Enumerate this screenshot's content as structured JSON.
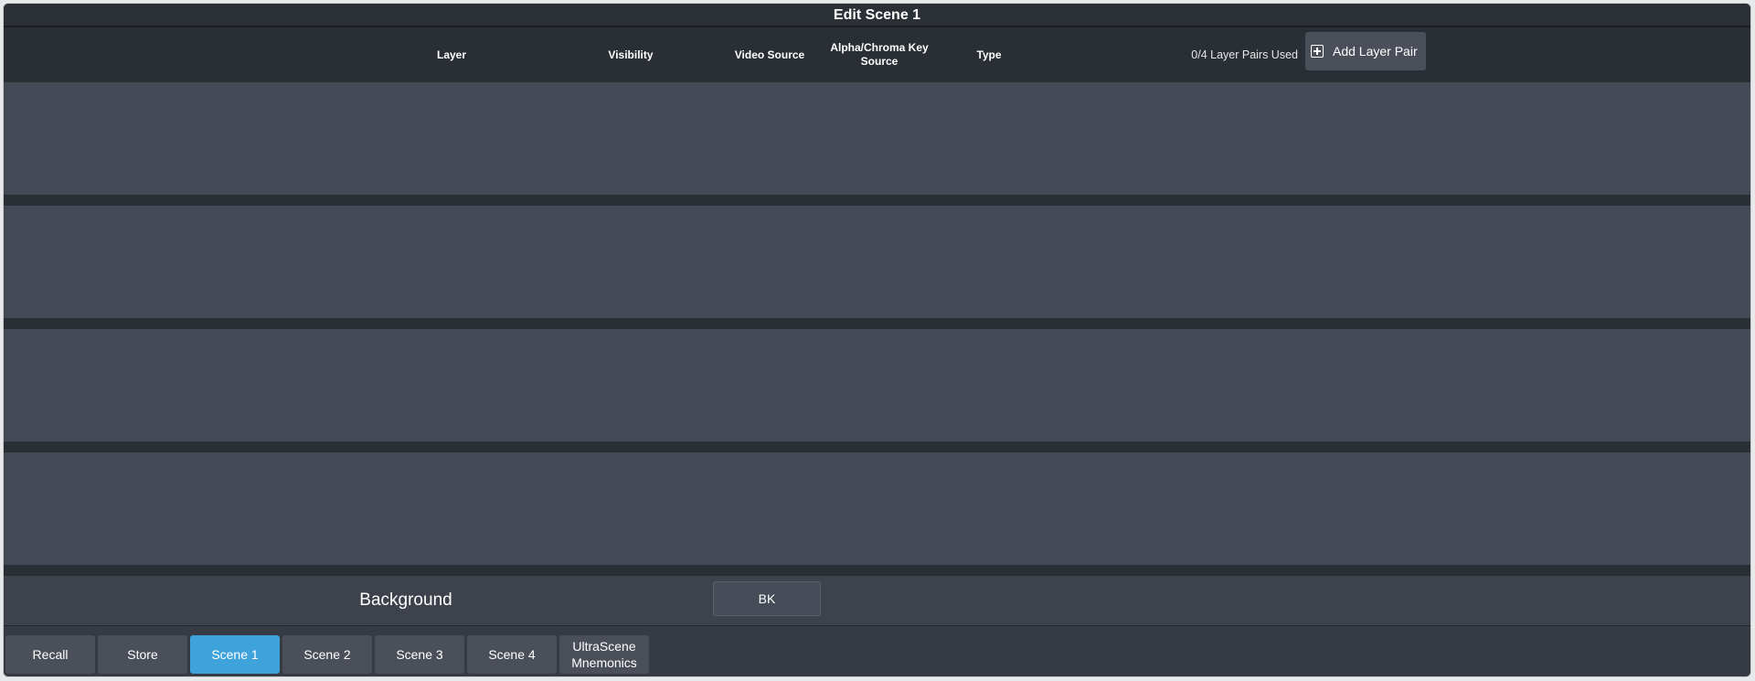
{
  "window": {
    "title": "Edit Scene 1"
  },
  "header": {
    "columns": {
      "layer": "Layer",
      "visibility": "Visibility",
      "video_source": "Video Source",
      "alpha_line1": "Alpha/Chroma Key",
      "alpha_line2": "Source",
      "type": "Type"
    },
    "pairs_used": "0/4 Layer Pairs Used",
    "add_label": "Add Layer Pair",
    "add_icon": "plus-square-icon"
  },
  "background": {
    "label": "Background",
    "button": "BK"
  },
  "tabs": {
    "recall": "Recall",
    "store": "Store",
    "scene1": "Scene 1",
    "scene2": "Scene 2",
    "scene3": "Scene 3",
    "scene4": "Scene 4",
    "mnemonics_line1": "UltraScene",
    "mnemonics_line2": "Mnemonics",
    "active": "Scene 1"
  },
  "colors": {
    "accent": "#3fa3db",
    "panel": "#434955",
    "background": "#2a2e35"
  }
}
